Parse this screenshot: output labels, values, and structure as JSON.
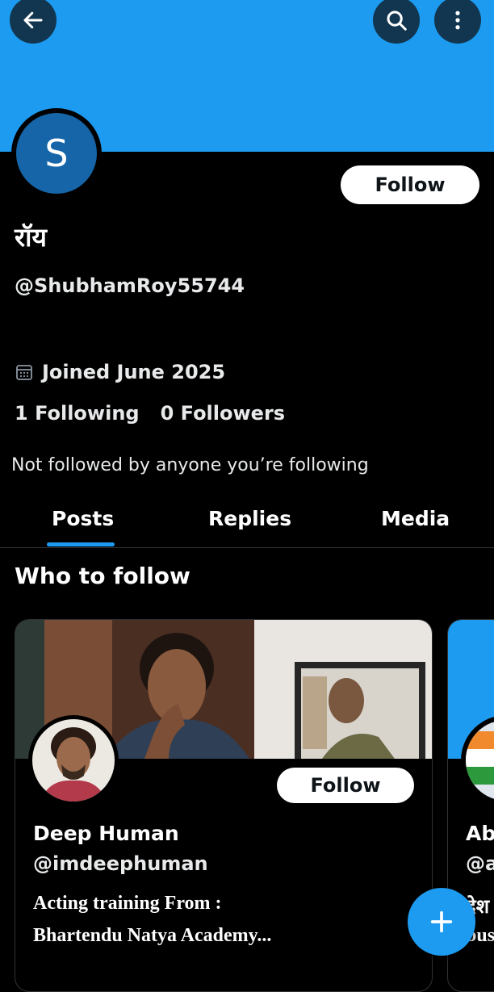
{
  "header": {
    "back_icon": "arrow-left-icon",
    "search_icon": "search-icon",
    "more_icon": "more-vertical-icon",
    "banner_color": "#1d9bf0"
  },
  "profile": {
    "avatar_letter": "S",
    "avatar_color": "#1565a8",
    "name": "रॉय",
    "handle": "@ShubhamRoy55744",
    "follow_label": "Follow",
    "joined": "Joined June 2025",
    "following_count": "1",
    "following_label": "Following",
    "followers_count": "0",
    "followers_label": "Followers",
    "not_followed_text": "Not followed by anyone you’re following"
  },
  "tabs": [
    {
      "label": "Posts",
      "active": true
    },
    {
      "label": "Replies",
      "active": false
    },
    {
      "label": "Media",
      "active": false
    }
  ],
  "who_to_follow": {
    "title": "Who to follow",
    "cards": [
      {
        "name": "Deep Human",
        "handle": "@imdeephuman",
        "follow_label": "Follow",
        "bio_line1": "Acting training From :",
        "bio_line2": "Bhartendu Natya Academy..."
      },
      {
        "name": "Ab",
        "handle": "@a",
        "bio_line1": "देश",
        "bio_line2": "bus"
      }
    ]
  },
  "fab": {
    "icon": "plus-icon"
  }
}
